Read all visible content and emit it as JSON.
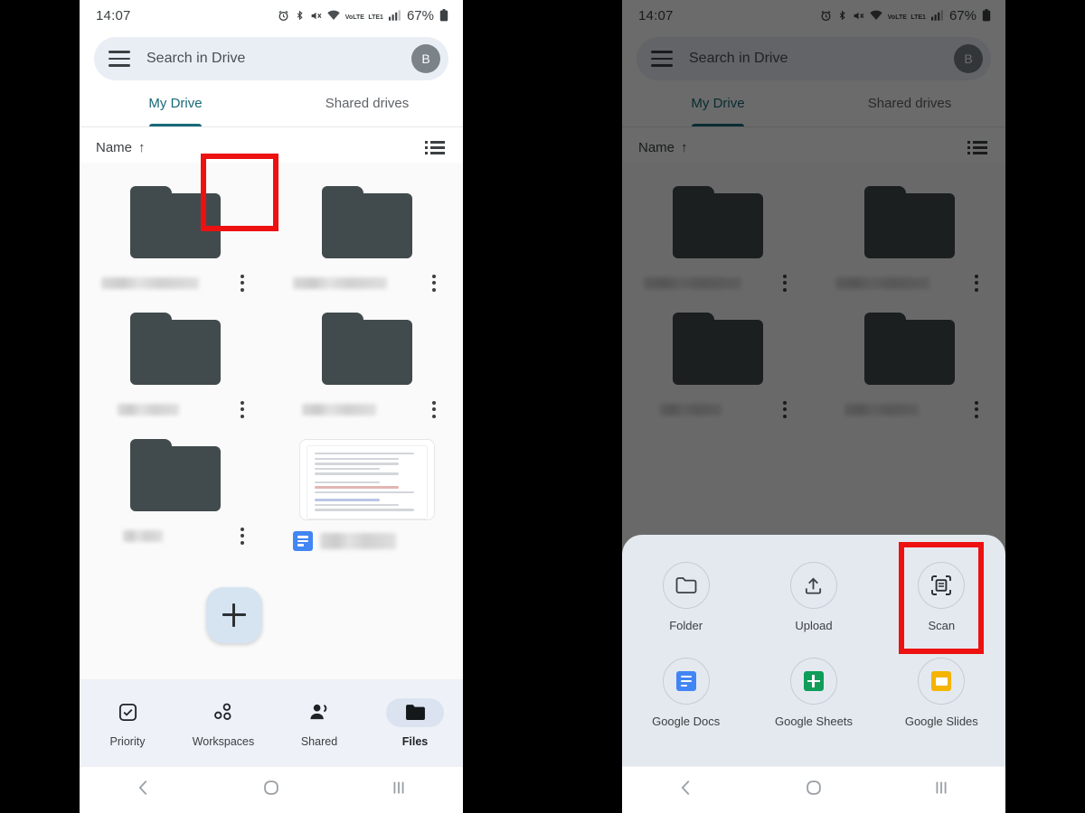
{
  "statusbar": {
    "time": "14:07",
    "battery_percent": "67%",
    "volte_label_top": "VoLTE",
    "volte_label_bottom": "LTE1",
    "icons": [
      "alarm-icon",
      "bluetooth-icon",
      "mute-icon",
      "wifi-icon",
      "volte-icon",
      "signal-icon",
      "battery-icon"
    ]
  },
  "search": {
    "placeholder": "Search in Drive",
    "menu_icon": "hamburger-menu-icon",
    "avatar_initial": "B"
  },
  "tabs": [
    {
      "label": "My Drive",
      "active": true
    },
    {
      "label": "Shared drives",
      "active": false
    }
  ],
  "sort": {
    "label": "Name",
    "direction_glyph": "↑",
    "view_toggle_icon": "list-view-icon"
  },
  "files": {
    "rows": [
      [
        {
          "type": "folder",
          "name_redacted": true
        },
        {
          "type": "folder",
          "name_redacted": true
        }
      ],
      [
        {
          "type": "folder",
          "name_redacted": true
        },
        {
          "type": "folder",
          "name_redacted": true
        }
      ],
      [
        {
          "type": "folder",
          "name_redacted": true
        },
        {
          "type": "document",
          "name_redacted": true,
          "badge": "google-docs-icon"
        }
      ]
    ]
  },
  "fab": {
    "icon": "plus-icon",
    "highlighted": true,
    "highlight_color": "#ee1111",
    "background_color": "#d6e4f2"
  },
  "bottom_nav": [
    {
      "label": "Priority",
      "icon": "priority-check-icon",
      "active": false
    },
    {
      "label": "Workspaces",
      "icon": "workspaces-dots-icon",
      "active": false
    },
    {
      "label": "Shared",
      "icon": "shared-people-icon",
      "active": false
    },
    {
      "label": "Files",
      "icon": "files-folder-icon",
      "active": true
    }
  ],
  "android_nav": {
    "back": "back-chevron-icon",
    "home": "home-circle-icon",
    "recents": "recents-bars-icon"
  },
  "create_sheet": {
    "row1": [
      {
        "label": "Folder",
        "icon": "folder-outline-icon",
        "highlighted": false
      },
      {
        "label": "Upload",
        "icon": "upload-arrow-icon",
        "highlighted": false
      },
      {
        "label": "Scan",
        "icon": "scan-document-icon",
        "highlighted": true
      }
    ],
    "row2": [
      {
        "label": "Google Docs",
        "icon": "google-docs-icon",
        "highlighted": false
      },
      {
        "label": "Google Sheets",
        "icon": "google-sheets-icon",
        "highlighted": false
      },
      {
        "label": "Google Slides",
        "icon": "google-slides-icon",
        "highlighted": false
      }
    ],
    "background_color": "#e4e9ef",
    "highlight_color": "#ee1111"
  },
  "colors": {
    "accent_teal": "#186a78",
    "folder_gray": "#414b4d",
    "scrim": "rgba(0,0,0,0.58)",
    "page_bg": "#000000"
  }
}
